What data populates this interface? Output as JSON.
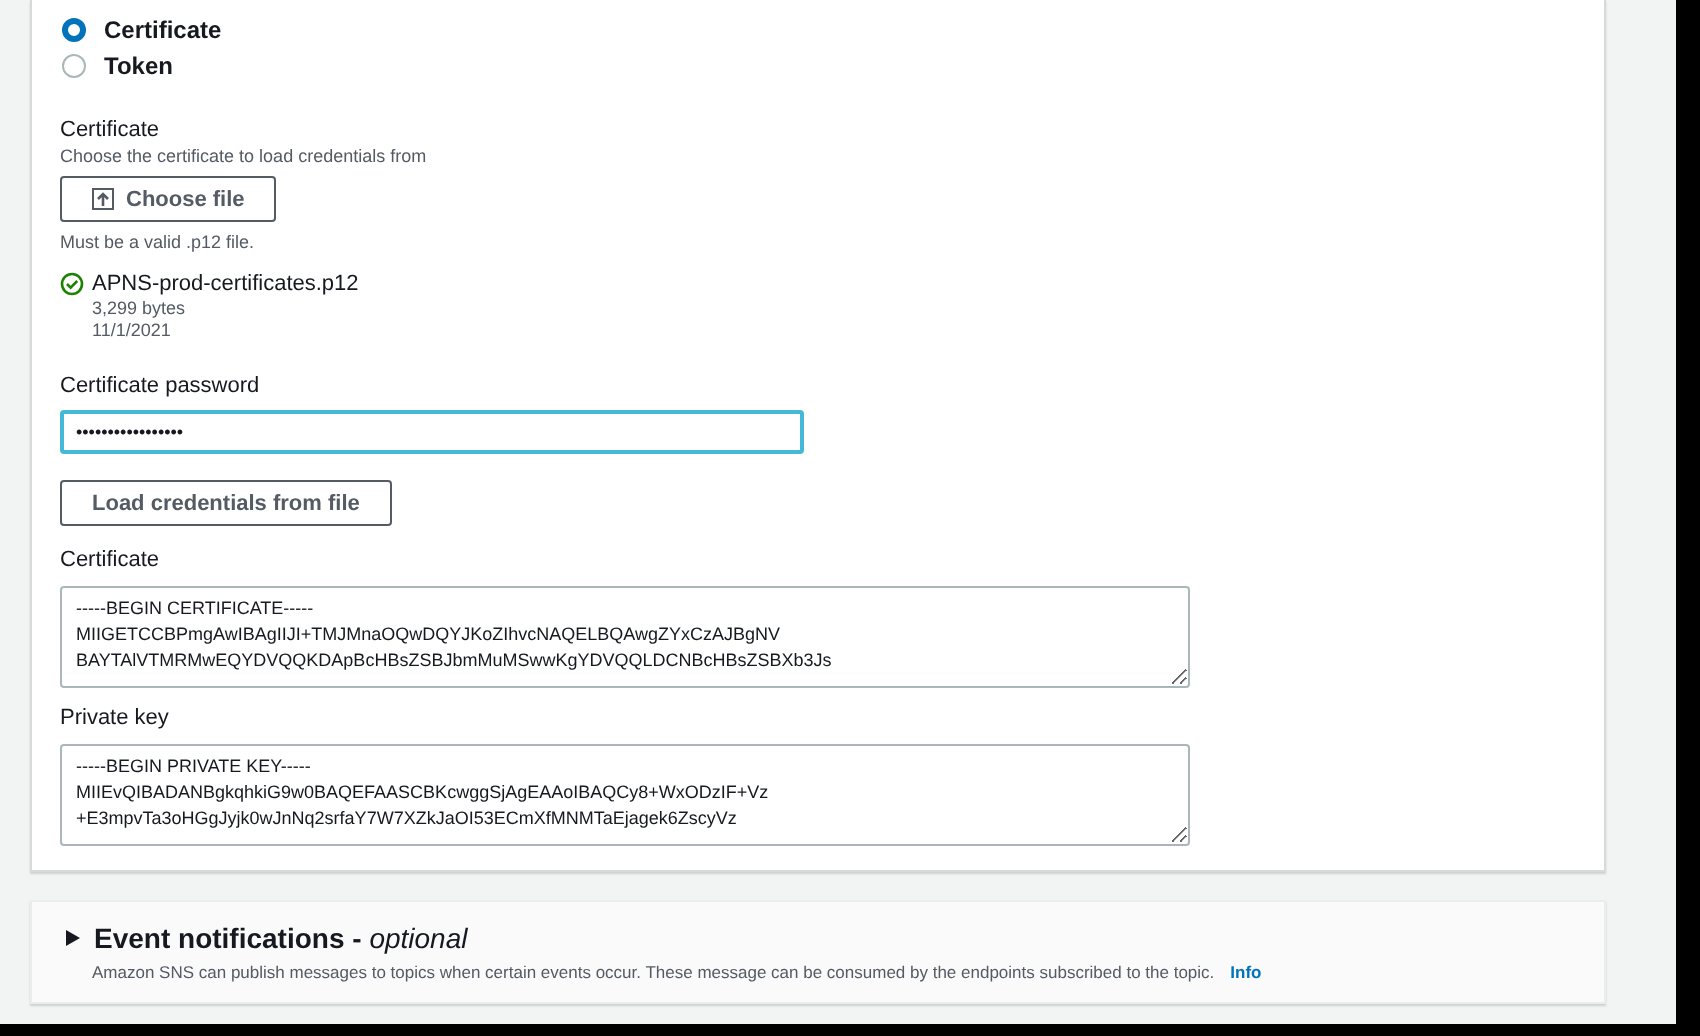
{
  "auth_method": {
    "options": [
      {
        "label": "Certificate",
        "selected": true
      },
      {
        "label": "Token",
        "selected": false
      }
    ]
  },
  "certificate_file": {
    "label": "Certificate",
    "description": "Choose the certificate to load credentials from",
    "button": "Choose file",
    "constraint": "Must be a valid .p12 file.",
    "file": {
      "name": "APNS-prod-certificates.p12",
      "size": "3,299 bytes",
      "date": "11/1/2021"
    }
  },
  "password": {
    "label": "Certificate password",
    "value": "•••••••••••••••••"
  },
  "load_button": "Load credentials from file",
  "certificate": {
    "label": "Certificate",
    "lines": [
      "-----BEGIN CERTIFICATE-----",
      "MIIGETCCBPmgAwIBAgIIJI+TMJMnaOQwDQYJKoZIhvcNAQELBQAwgZYxCzAJBgNV",
      "BAYTAlVTMRMwEQYDVQQKDApBcHBsZSBJbmMuMSwwKgYDVQQLDCNBcHBsZSBXb3Js"
    ]
  },
  "private_key": {
    "label": "Private key",
    "lines": [
      "-----BEGIN PRIVATE KEY-----",
      "MIIEvQIBADANBgkqhkiG9w0BAQEFAASCBKcwggSjAgEAAoIBAQCy8+WxODzIF+Vz",
      "+E3mpvTa3oHGgJyjk0wJnNq2srfaY7W7XZkJaOI53ECmXfMNMTaEjagek6ZscyVz"
    ]
  },
  "event_notifications": {
    "title": "Event notifications -",
    "suffix": "optional",
    "expanded": false,
    "description": "Amazon SNS can publish messages to topics when certain events occur. These message can be consumed by the endpoints subscribed to the topic.",
    "info_link": "Info"
  }
}
